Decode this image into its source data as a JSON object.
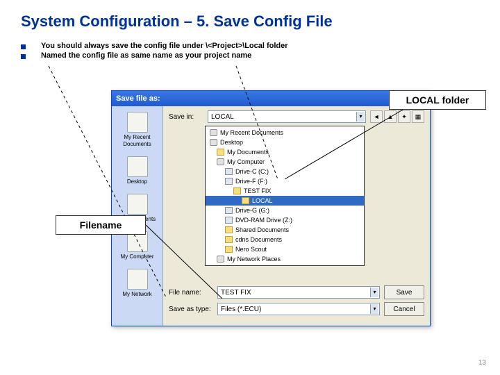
{
  "title": "System Configuration – 5. Save Config File",
  "bullets": [
    "You should always save the config file under \\<Project>\\Local folder",
    "Named the config file as same name as your project name"
  ],
  "callouts": {
    "local_folder": "LOCAL folder",
    "filename": "Filename"
  },
  "dialog": {
    "title": "Save file as:",
    "savein_label": "Save in:",
    "savein_value": "LOCAL",
    "places": [
      "My Recent Documents",
      "Desktop",
      "My Documents",
      "My Computer",
      "My Network"
    ],
    "tree": [
      {
        "label": "My Recent Documents",
        "indent": 0,
        "type": "place"
      },
      {
        "label": "Desktop",
        "indent": 0,
        "type": "place"
      },
      {
        "label": "My Documents",
        "indent": 1,
        "type": "folder"
      },
      {
        "label": "My Computer",
        "indent": 1,
        "type": "place"
      },
      {
        "label": "Drive-C (C:)",
        "indent": 2,
        "type": "drive"
      },
      {
        "label": "Drive-F (F:)",
        "indent": 2,
        "type": "drive"
      },
      {
        "label": "TEST FIX",
        "indent": 3,
        "type": "folder"
      },
      {
        "label": "LOCAL",
        "indent": 4,
        "type": "folder",
        "selected": true
      },
      {
        "label": "Drive-G (G:)",
        "indent": 2,
        "type": "drive"
      },
      {
        "label": "DVD-RAM Drive (Z:)",
        "indent": 2,
        "type": "drive"
      },
      {
        "label": "Shared Documents",
        "indent": 2,
        "type": "folder"
      },
      {
        "label": "cdns Documents",
        "indent": 2,
        "type": "folder"
      },
      {
        "label": "Nero Scout",
        "indent": 2,
        "type": "folder"
      },
      {
        "label": "My Network Places",
        "indent": 1,
        "type": "place"
      }
    ],
    "filename_label": "File name:",
    "filename_value": "TEST FIX",
    "savetype_label": "Save as type:",
    "savetype_value": "Files (*.ECU)",
    "save_btn": "Save",
    "cancel_btn": "Cancel"
  },
  "slide_number": "13"
}
